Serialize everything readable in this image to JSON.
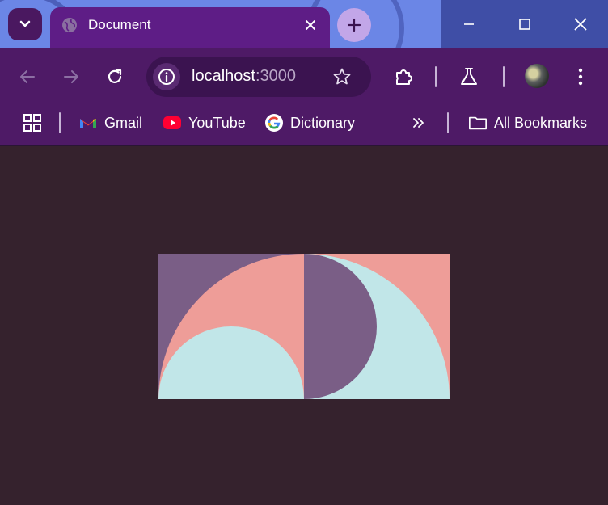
{
  "tab": {
    "title": "Document"
  },
  "omnibox": {
    "host": "localhost",
    "port": ":3000"
  },
  "bookmarks": {
    "items": [
      {
        "label": "Gmail",
        "icon": "gmail-icon"
      },
      {
        "label": "YouTube",
        "icon": "youtube-icon"
      },
      {
        "label": "Dictionary",
        "icon": "google-icon"
      }
    ],
    "all_label": "All Bookmarks"
  },
  "icons": {
    "tab_search": "chevron-down-icon",
    "favicon": "globe-icon",
    "close": "close-icon",
    "new_tab": "plus-icon",
    "back": "back-arrow-icon",
    "forward": "forward-arrow-icon",
    "reload": "reload-icon",
    "info": "info-icon",
    "star": "star-icon",
    "extensions": "puzzle-icon",
    "labs": "flask-icon",
    "menu": "kebab-menu-icon",
    "apps": "apps-grid-icon",
    "overflow": "double-chevron-icon",
    "folder": "folder-icon"
  },
  "colors": {
    "page_background": "#35222d",
    "art_purple": "#7a5e86",
    "art_salmon": "#ee9d98",
    "art_cyan": "#c1e6e8"
  }
}
